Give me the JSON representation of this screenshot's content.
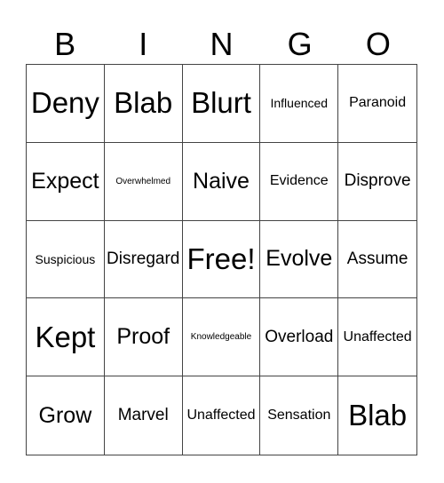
{
  "header": {
    "letters": [
      "B",
      "I",
      "N",
      "G",
      "O"
    ]
  },
  "board": {
    "rows": [
      [
        "Deny",
        "Blab",
        "Blurt",
        "Influenced",
        "Paranoid"
      ],
      [
        "Expect",
        "Overwhelmed",
        "Naive",
        "Evidence",
        "Disprove"
      ],
      [
        "Suspicious",
        "Disregard",
        "Free!",
        "Evolve",
        "Assume"
      ],
      [
        "Kept",
        "Proof",
        "Knowledgeable",
        "Overload",
        "Unaffected"
      ],
      [
        "Grow",
        "Marvel",
        "Unaffected",
        "Sensation",
        "Blab"
      ]
    ]
  }
}
